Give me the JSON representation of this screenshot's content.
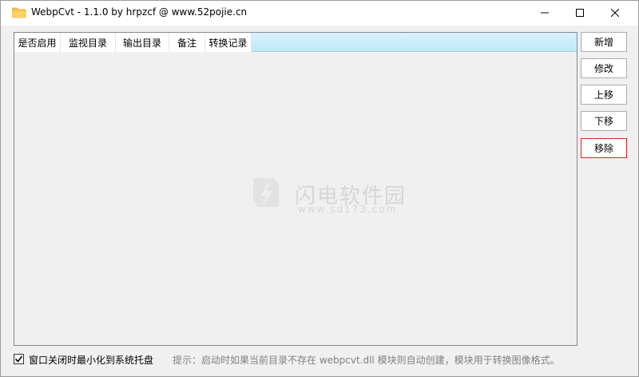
{
  "window": {
    "title": "WebpCvt - 1.1.0 by hrpzcf @ www.52pojie.cn",
    "icon": "folder-icon"
  },
  "titlebar_buttons": {
    "minimize": "minimize-icon",
    "maximize": "maximize-icon",
    "close": "close-icon"
  },
  "table": {
    "columns": [
      {
        "label": "是否启用"
      },
      {
        "label": "监视目录"
      },
      {
        "label": "输出目录"
      },
      {
        "label": "备注"
      },
      {
        "label": "转换记录"
      }
    ],
    "rows": []
  },
  "watermark": {
    "title": "闪电软件园",
    "subtitle": "www.sd173.com"
  },
  "actions": {
    "add": "新增",
    "edit": "修改",
    "move_up": "上移",
    "move_down": "下移",
    "remove": "移除"
  },
  "footer": {
    "minimize_to_tray_label": "窗口关闭时最小化到系统托盘",
    "minimize_to_tray_checked": true,
    "hint": "提示：启动时如果当前目录不存在 webpcvt.dll 模块则自动创建，模块用于转换图像格式。"
  },
  "colors": {
    "accent_header": "#c1e8fa",
    "danger_border": "#e0201b",
    "folder": "#f8c24c"
  }
}
